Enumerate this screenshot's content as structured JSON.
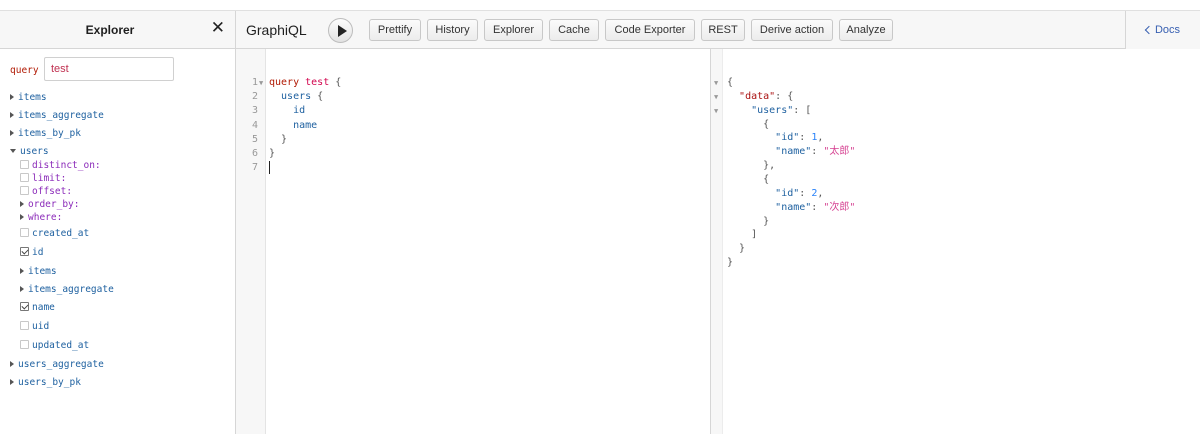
{
  "explorer": {
    "title": "Explorer",
    "close_icon": "close-icon",
    "query_keyword": "query",
    "query_name": "test",
    "tree": [
      {
        "label": "items",
        "kind": "collapsed"
      },
      {
        "label": "items_aggregate",
        "kind": "collapsed"
      },
      {
        "label": "items_by_pk",
        "kind": "collapsed"
      },
      {
        "label": "users",
        "kind": "expanded"
      },
      {
        "label": "distinct_on:",
        "kind": "arg-checkbox",
        "checked": false
      },
      {
        "label": "limit:",
        "kind": "arg-checkbox",
        "checked": false
      },
      {
        "label": "offset:",
        "kind": "arg-checkbox",
        "checked": false
      },
      {
        "label": "order_by:",
        "kind": "arg-collapsed"
      },
      {
        "label": "where:",
        "kind": "arg-collapsed"
      },
      {
        "label": "created_at",
        "kind": "field-checkbox",
        "checked": false
      },
      {
        "label": "id",
        "kind": "field-checkbox",
        "checked": true
      },
      {
        "label": "items",
        "kind": "field-collapsed"
      },
      {
        "label": "items_aggregate",
        "kind": "field-collapsed"
      },
      {
        "label": "name",
        "kind": "field-checkbox",
        "checked": true
      },
      {
        "label": "uid",
        "kind": "field-checkbox",
        "checked": false
      },
      {
        "label": "updated_at",
        "kind": "field-checkbox",
        "checked": false
      },
      {
        "label": "users_aggregate",
        "kind": "collapsed"
      },
      {
        "label": "users_by_pk",
        "kind": "collapsed"
      }
    ]
  },
  "toolbar": {
    "brand": "GraphiQL",
    "run_icon": "play-icon",
    "buttons": [
      "Prettify",
      "History",
      "Explorer",
      "Cache",
      "Code Exporter",
      "REST",
      "Derive action",
      "Analyze"
    ],
    "docs_label": "Docs"
  },
  "editor": {
    "line_numbers": [
      "1",
      "2",
      "3",
      "4",
      "5",
      "6",
      "7"
    ],
    "lines": [
      {
        "tokens": [
          {
            "t": "query",
            "c": "kw"
          },
          {
            "t": " ",
            "c": "punc"
          },
          {
            "t": "test",
            "c": "def"
          },
          {
            "t": " {",
            "c": "punc"
          }
        ]
      },
      {
        "tokens": [
          {
            "t": "  users",
            "c": "prop"
          },
          {
            "t": " {",
            "c": "punc"
          }
        ]
      },
      {
        "tokens": [
          {
            "t": "    id",
            "c": "prop"
          }
        ]
      },
      {
        "tokens": [
          {
            "t": "    name",
            "c": "prop"
          }
        ]
      },
      {
        "tokens": [
          {
            "t": "  }",
            "c": "punc"
          }
        ]
      },
      {
        "tokens": [
          {
            "t": "}",
            "c": "punc"
          }
        ]
      },
      {
        "tokens": []
      }
    ]
  },
  "results": {
    "lines": [
      [
        {
          "t": "{",
          "c": "punc"
        }
      ],
      [
        {
          "t": "  ",
          "c": "punc"
        },
        {
          "t": "\"data\"",
          "c": "rkey"
        },
        {
          "t": ": {",
          "c": "punc"
        }
      ],
      [
        {
          "t": "    ",
          "c": "punc"
        },
        {
          "t": "\"users\"",
          "c": "rkey2"
        },
        {
          "t": ": [",
          "c": "punc"
        }
      ],
      [
        {
          "t": "      {",
          "c": "punc"
        }
      ],
      [
        {
          "t": "        ",
          "c": "punc"
        },
        {
          "t": "\"id\"",
          "c": "rkey2"
        },
        {
          "t": ": ",
          "c": "punc"
        },
        {
          "t": "1",
          "c": "rnum"
        },
        {
          "t": ",",
          "c": "punc"
        }
      ],
      [
        {
          "t": "        ",
          "c": "punc"
        },
        {
          "t": "\"name\"",
          "c": "rkey2"
        },
        {
          "t": ": ",
          "c": "punc"
        },
        {
          "t": "\"太郎\"",
          "c": "rstr"
        }
      ],
      [
        {
          "t": "      },",
          "c": "punc"
        }
      ],
      [
        {
          "t": "      {",
          "c": "punc"
        }
      ],
      [
        {
          "t": "        ",
          "c": "punc"
        },
        {
          "t": "\"id\"",
          "c": "rkey2"
        },
        {
          "t": ": ",
          "c": "punc"
        },
        {
          "t": "2",
          "c": "rnum"
        },
        {
          "t": ",",
          "c": "punc"
        }
      ],
      [
        {
          "t": "        ",
          "c": "punc"
        },
        {
          "t": "\"name\"",
          "c": "rkey2"
        },
        {
          "t": ": ",
          "c": "punc"
        },
        {
          "t": "\"次郎\"",
          "c": "rstr"
        }
      ],
      [
        {
          "t": "      }",
          "c": "punc"
        }
      ],
      [
        {
          "t": "    ]",
          "c": "punc"
        }
      ],
      [
        {
          "t": "  }",
          "c": "punc"
        }
      ],
      [
        {
          "t": "}",
          "c": "punc"
        }
      ]
    ]
  }
}
